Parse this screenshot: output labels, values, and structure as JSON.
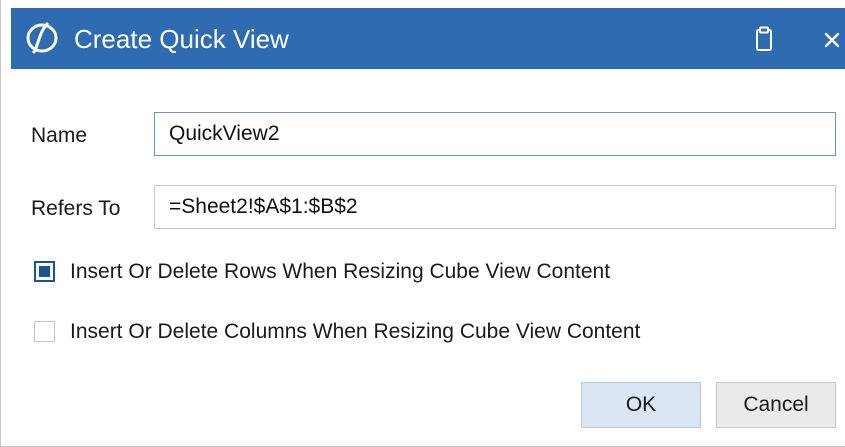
{
  "window": {
    "title": "Create Quick View",
    "logo_icon": "onestream-logo-icon",
    "clipboard_icon": "clipboard-icon",
    "close_icon": "close-icon",
    "titlebar_color": "#2e6bb0"
  },
  "form": {
    "name_label": "Name",
    "name_value": "QuickView2",
    "refers_label": "Refers To",
    "refers_value": "=Sheet2!$A$1:$B$2"
  },
  "options": [
    {
      "label": "Insert Or Delete Rows When Resizing Cube View Content",
      "checked": true
    },
    {
      "label": "Insert Or Delete Columns When Resizing Cube View Content",
      "checked": false
    }
  ],
  "buttons": {
    "ok_label": "OK",
    "cancel_label": "Cancel"
  }
}
